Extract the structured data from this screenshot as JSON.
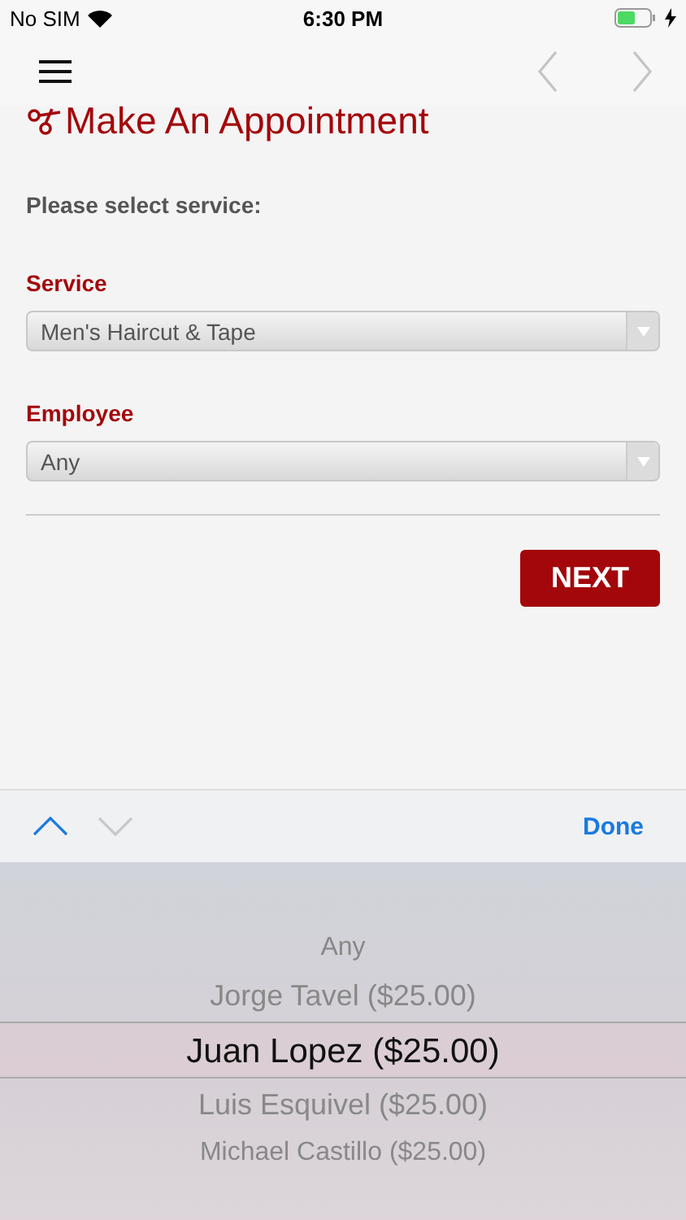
{
  "status_bar": {
    "carrier": "No SIM",
    "time": "6:30 PM",
    "charging": true
  },
  "nav": {
    "back_disabled": true,
    "forward_disabled": true
  },
  "page": {
    "title": "Make An Appointment",
    "prompt": "Please select service:",
    "fields": [
      {
        "label": "Service",
        "value": "Men's Haircut & Tape"
      },
      {
        "label": "Employee",
        "value": "Any"
      }
    ],
    "next_button": "NEXT"
  },
  "accessory": {
    "up_disabled": false,
    "down_disabled": true,
    "done": "Done"
  },
  "picker": [
    {
      "label": "Any",
      "selected": false
    },
    {
      "label": "Jorge Tavel ($25.00)",
      "selected": false
    },
    {
      "label": "Juan Lopez ($25.00)",
      "selected": true
    },
    {
      "label": "Luis Esquivel ($25.00)",
      "selected": false
    },
    {
      "label": "Michael Castillo ($25.00)",
      "selected": false
    }
  ]
}
